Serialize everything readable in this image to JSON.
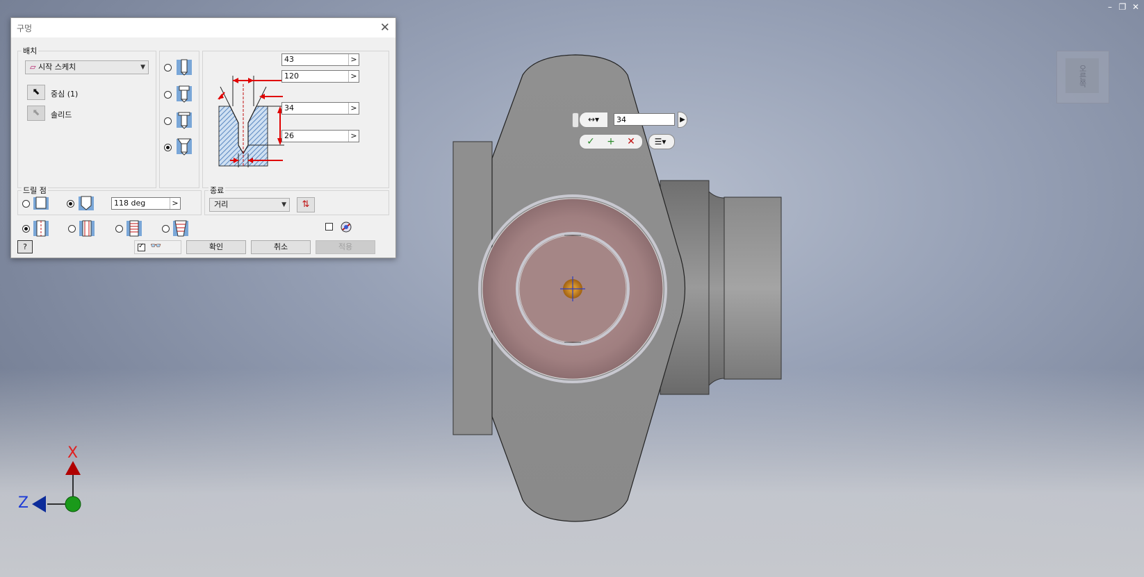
{
  "window_controls": {
    "minimize": "–",
    "restore": "❐",
    "close": "✕"
  },
  "viewcube": {
    "face_label": "오른쪽"
  },
  "minitoolbar": {
    "dimension_value": "34",
    "dim_icon": "↔▾",
    "ok_icon": "✓",
    "add_icon": "+",
    "cancel_icon": "✕",
    "options_icon": "☰▾"
  },
  "triad": {
    "x_label": "X",
    "z_label": "Z"
  },
  "dialog": {
    "title": "구멍",
    "close_icon": "✕",
    "placement": {
      "group_label": "배치",
      "sketch_combo": "시작 스케치",
      "center_label": "중심 (1)",
      "solid_label": "솔리드"
    },
    "dimensions": {
      "countersink_dia": "43",
      "countersink_angle": "120",
      "depth": "34",
      "hole_dia": "26"
    },
    "drill_point": {
      "group_label": "드릴 점",
      "angle_value": "118 deg"
    },
    "termination": {
      "group_label": "종료",
      "combo": "거리"
    },
    "buttons": {
      "ok": "확인",
      "cancel": "취소",
      "apply": "적용",
      "help": "?"
    }
  },
  "colors": {
    "dim_red": "#e00000",
    "hatch_blue": "#6a95c8",
    "part_gray": "#8e8e8e",
    "hole_pink": "#a88888",
    "center_orange": "#c87a10"
  }
}
